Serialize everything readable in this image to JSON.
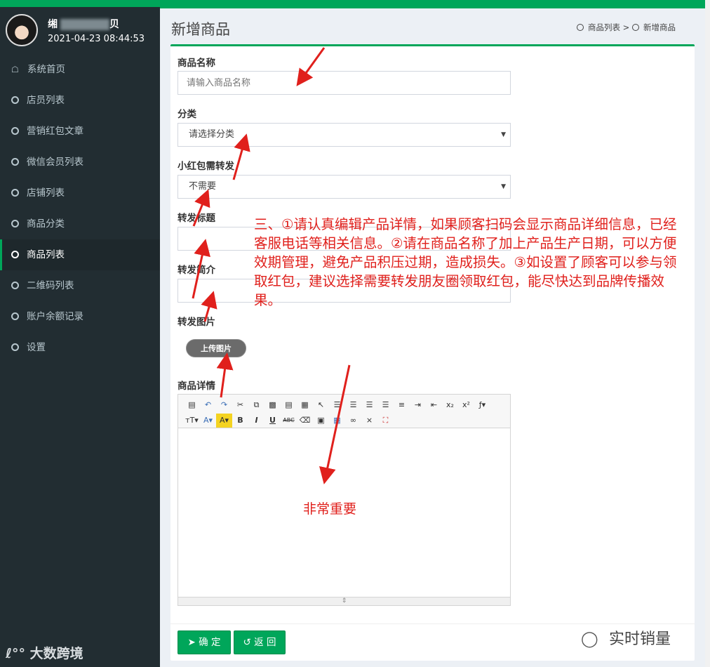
{
  "user": {
    "name_visible": "缃",
    "name_tail": "贝",
    "datetime": "2021-04-23 08:44:53"
  },
  "sidebar": {
    "items": [
      {
        "label": "系统首页",
        "icon": "home-icon"
      },
      {
        "label": "店员列表",
        "icon": "circle-icon"
      },
      {
        "label": "营销红包文章",
        "icon": "circle-icon"
      },
      {
        "label": "微信会员列表",
        "icon": "circle-icon"
      },
      {
        "label": "店铺列表",
        "icon": "circle-icon"
      },
      {
        "label": "商品分类",
        "icon": "circle-icon"
      },
      {
        "label": "商品列表",
        "icon": "circle-icon",
        "active": true
      },
      {
        "label": "二维码列表",
        "icon": "circle-icon"
      },
      {
        "label": "账户余额记录",
        "icon": "circle-icon"
      },
      {
        "label": "设置",
        "icon": "circle-icon"
      }
    ]
  },
  "header": {
    "title": "新增商品",
    "breadcrumb": [
      "商品列表",
      ">",
      "新增商品"
    ]
  },
  "form": {
    "name_label": "商品名称",
    "name_placeholder": "请输入商品名称",
    "category_label": "分类",
    "category_value": "请选择分类",
    "share_label": "小红包需转发",
    "share_value": "不需要",
    "share_title_label": "转发标题",
    "share_desc_label": "转发简介",
    "share_image_label": "转发图片",
    "upload_button": "上传图片",
    "detail_label": "商品详情",
    "submit_button": "确 定",
    "back_button": "返 回"
  },
  "annotations": {
    "main": "三、①请认真编辑产品详情，如果顾客扫码会显示商品详细信息，已经客服电话等相关信息。②请在商品名称了加上产品生产日期，可以方便效期管理，避免产品积压过期，造成损失。③如设置了顾客可以参与领取红包，建议选择需要转发朋友圈领取红包，能尽快达到品牌传播效果。",
    "important": "非常重要"
  },
  "watermarks": {
    "left": "大数跨境",
    "right": "实时销量"
  },
  "colors": {
    "accent": "#00a65a",
    "sidebar": "#222d32",
    "annotation": "#e0201c"
  }
}
